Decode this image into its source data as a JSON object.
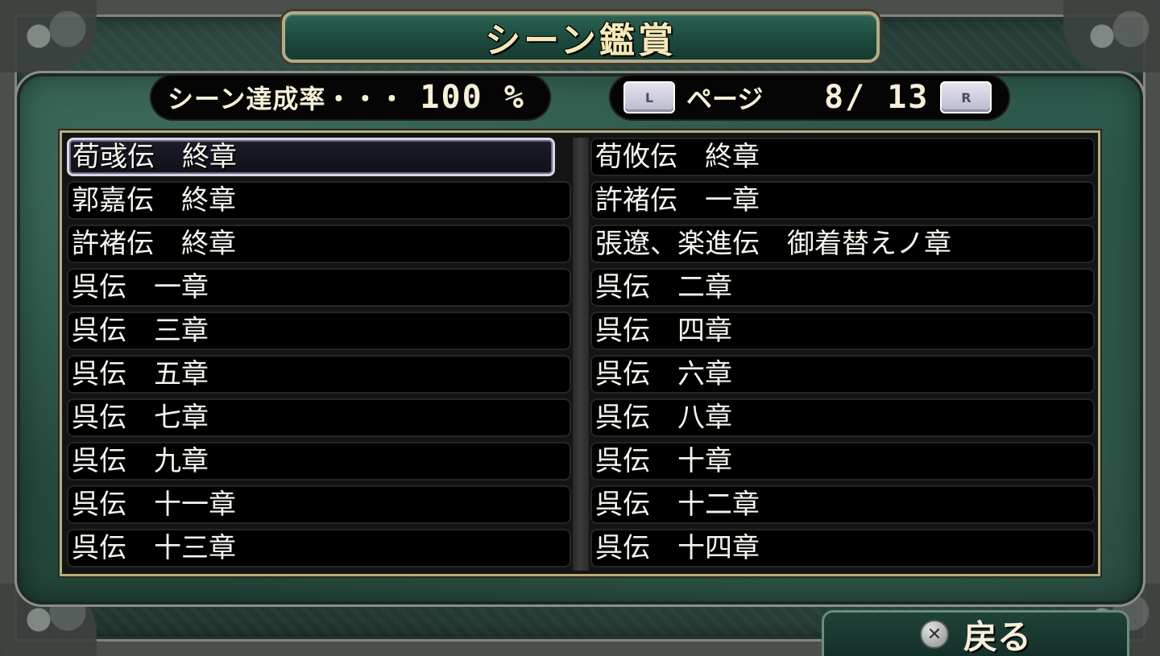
{
  "title": "シーン鑑賞",
  "completion": {
    "label": "シーン達成率・・・",
    "value": "100 %"
  },
  "pager": {
    "left_key": "L",
    "label": "ページ",
    "value": "8/ 13",
    "right_key": "R"
  },
  "scenes": {
    "left": [
      {
        "label": "荀彧伝　終章",
        "selected": true
      },
      {
        "label": "郭嘉伝　終章"
      },
      {
        "label": "許褚伝　終章"
      },
      {
        "label": "呉伝　一章"
      },
      {
        "label": "呉伝　三章"
      },
      {
        "label": "呉伝　五章"
      },
      {
        "label": "呉伝　七章"
      },
      {
        "label": "呉伝　九章"
      },
      {
        "label": "呉伝　十一章"
      },
      {
        "label": "呉伝　十三章"
      }
    ],
    "right": [
      {
        "label": "荀攸伝　終章"
      },
      {
        "label": "許褚伝　一章"
      },
      {
        "label": "張遼、楽進伝　御着替えノ章"
      },
      {
        "label": "呉伝　二章"
      },
      {
        "label": "呉伝　四章"
      },
      {
        "label": "呉伝　六章"
      },
      {
        "label": "呉伝　八章"
      },
      {
        "label": "呉伝　十章"
      },
      {
        "label": "呉伝　十二章"
      },
      {
        "label": "呉伝　十四章"
      }
    ]
  },
  "back": {
    "icon": "cross-button-icon",
    "label": "戻る"
  },
  "colors": {
    "panel_green": "#2f5a4d",
    "title_text": "#f3e9b8",
    "frame_gold": "#b6ad7e"
  }
}
